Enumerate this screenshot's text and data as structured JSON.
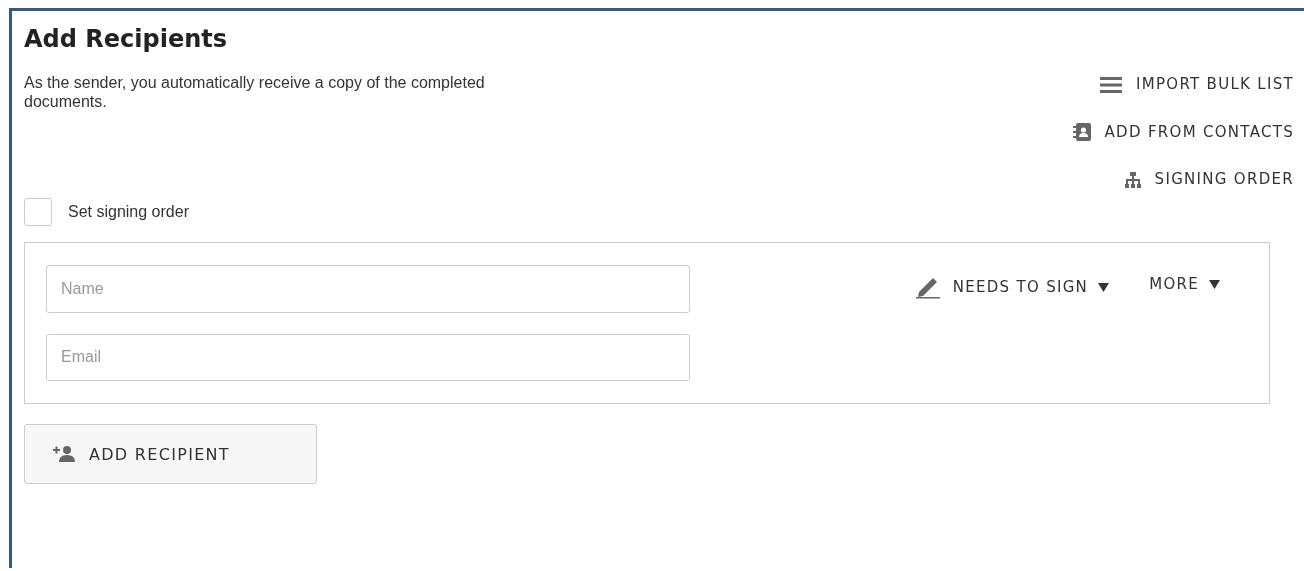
{
  "title": "Add Recipients",
  "description": "As the sender, you automatically receive a copy of the completed documents.",
  "actions": [
    {
      "kind": "list",
      "label": "IMPORT BULK LIST"
    },
    {
      "kind": "contacts",
      "label": "ADD FROM CONTACTS"
    },
    {
      "kind": "order",
      "label": "SIGNING ORDER"
    }
  ],
  "signing_order_checkbox": {
    "label": "Set signing order",
    "checked": false
  },
  "recipient": {
    "name": {
      "placeholder": "Name"
    },
    "email": {
      "placeholder": "Email"
    },
    "role": "NEEDS TO SIGN",
    "more": "MORE"
  },
  "add_button": "ADD RECIPIENT"
}
